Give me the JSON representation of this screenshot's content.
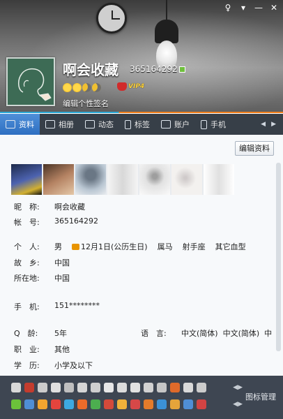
{
  "window": {
    "controls": [
      "♀",
      "▾",
      "—",
      "✕"
    ]
  },
  "profile": {
    "nickname": "啊会收藏",
    "qq_number": "365164292",
    "vip_label": "VIP4",
    "signature_placeholder": "编辑个性签名"
  },
  "tabs": [
    {
      "label": "资料",
      "active": true
    },
    {
      "label": "相册",
      "active": false
    },
    {
      "label": "动态",
      "active": false
    },
    {
      "label": "标签",
      "active": false
    },
    {
      "label": "账户",
      "active": false
    },
    {
      "label": "手机",
      "active": false
    }
  ],
  "edit_button_label": "编辑资料",
  "info": {
    "nickname": {
      "label": "昵　称:",
      "value": "啊会收藏"
    },
    "account": {
      "label": "帐　号:",
      "value": "365164292"
    },
    "personal": {
      "label": "个　人:",
      "gender": "男",
      "birthday": "12月1日(公历生日)",
      "zodiac": "属马",
      "constellation": "射手座",
      "blood": "其它血型"
    },
    "hometown": {
      "label": "故　乡:",
      "value": "中国"
    },
    "location": {
      "label": "所在地:",
      "value": "中国"
    },
    "phone": {
      "label": "手　机:",
      "value": "151********"
    },
    "qage": {
      "label": "Q　龄:",
      "value": "5年"
    },
    "language": {
      "label": "语　言:",
      "value": "中文(简体)  中文(简体)  中"
    },
    "job": {
      "label": "职　业:",
      "value": "其他"
    },
    "education": {
      "label": "学　历:",
      "value": "小学及以下"
    }
  },
  "tray": {
    "manage_label": "图标管理",
    "row1_colors": [
      "#d9d9d9",
      "#c43c2e",
      "#cccccc",
      "#e0e0e0",
      "#bfbfbf",
      "#d6d6d6",
      "#cfcfcf",
      "#e7e7e7",
      "#dcdcdc",
      "#e2e2e2",
      "#d2d2d2",
      "#c7c7c7",
      "#e06a2a",
      "#dadada",
      "#cccccc"
    ],
    "row2_colors": [
      "#6bc23a",
      "#4f8ed6",
      "#f2a52f",
      "#e5443d",
      "#3da9e0",
      "#eb6b2a",
      "#4cae4f",
      "#d44a3a",
      "#f0b23a",
      "#d64848",
      "#e47b2b",
      "#3b91d7",
      "#e5a43a",
      "#4f8ed6",
      "#d14343"
    ]
  }
}
